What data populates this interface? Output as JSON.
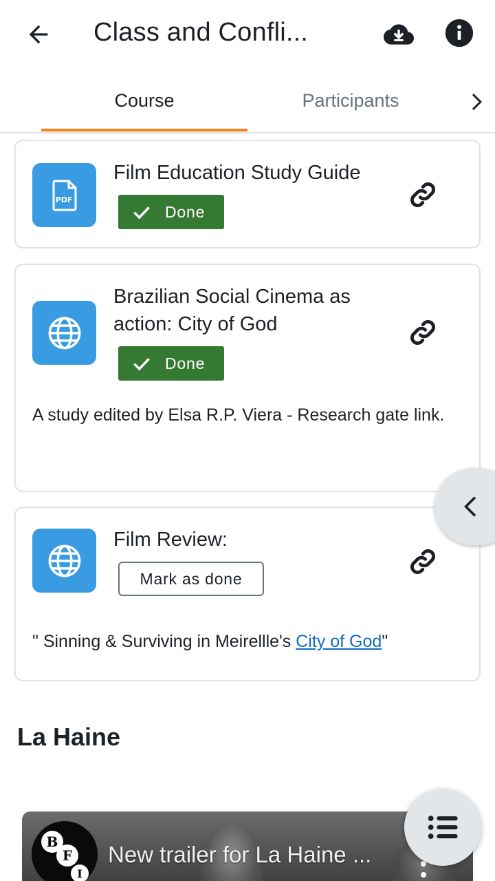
{
  "header": {
    "title": "Class and Confli...",
    "icons": {
      "back": "arrow-back-icon",
      "download": "cloud-download-icon",
      "info": "info-icon"
    }
  },
  "tabs": {
    "items": [
      {
        "label": "Course",
        "active": true
      },
      {
        "label": "Participants",
        "active": false
      }
    ],
    "next_icon": "chevron-right-icon",
    "accent": "#f98012"
  },
  "modules": [
    {
      "icon": "pdf-file-icon",
      "icon_text": "PDF",
      "title": "Film Education Study Guide",
      "completion": "Done",
      "link_icon": "link-icon"
    },
    {
      "icon": "globe-icon",
      "title": "Brazilian Social Cinema as action: City of God",
      "completion": "Done",
      "description": "A study edited by Elsa R.P. Viera  - Research gate link.",
      "link_icon": "link-icon"
    },
    {
      "icon": "globe-icon",
      "title": "Film Review:",
      "completion_button": "Mark as done",
      "description_prefix": "\" Sinning & Surviving in Meirellle's ",
      "description_link": "City of God",
      "description_suffix": "\"",
      "link_icon": "link-icon"
    }
  ],
  "section": {
    "title": "La Haine"
  },
  "video": {
    "title": "New trailer for La Haine ...",
    "channel_logo_letters": [
      "B",
      "F",
      "I"
    ]
  },
  "drawer_toggle_icon": "chevron-left-icon",
  "fab_icon": "list-icon",
  "colors": {
    "done_green": "#357a32",
    "module_blue": "#399be2",
    "link_blue": "#0f6cbf"
  }
}
